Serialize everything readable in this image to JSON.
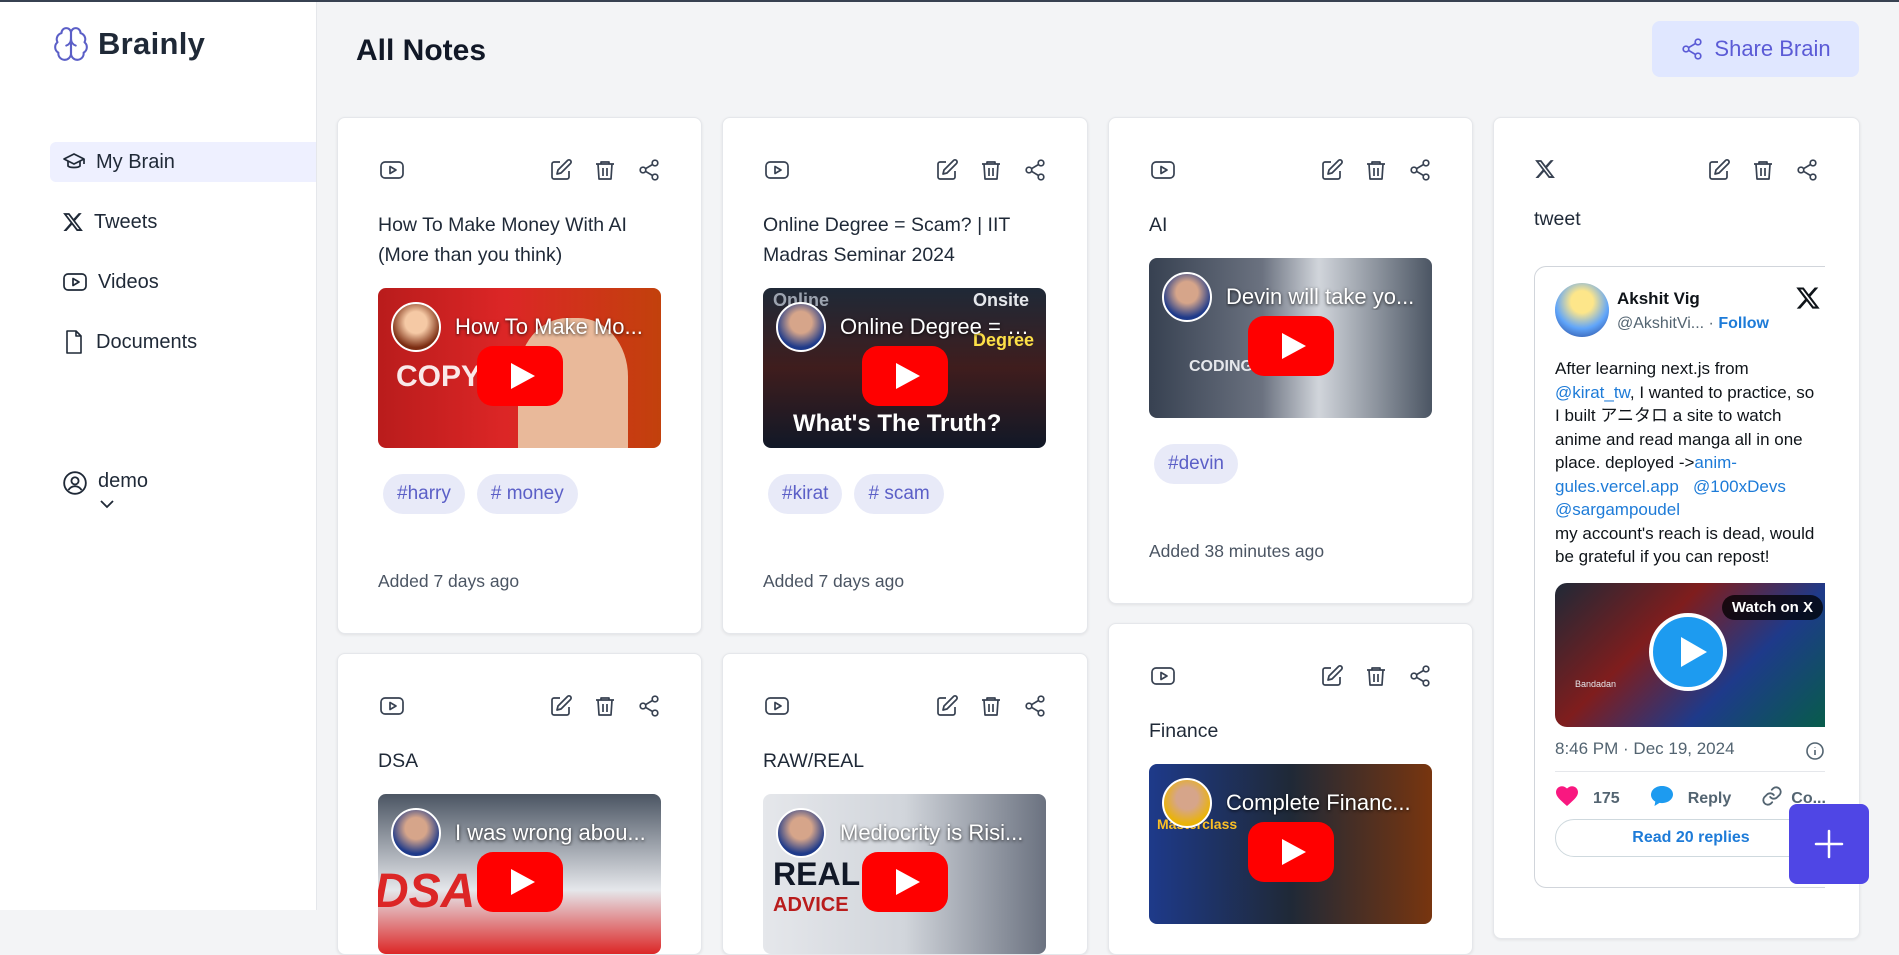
{
  "app": {
    "name": "Brainly"
  },
  "sidebar": {
    "items": [
      {
        "label": "My Brain",
        "icon": "graduation-cap-icon",
        "active": true
      },
      {
        "label": "Tweets",
        "icon": "x-logo-icon"
      },
      {
        "label": "Videos",
        "icon": "youtube-icon"
      },
      {
        "label": "Documents",
        "icon": "document-icon"
      }
    ],
    "user": {
      "name": "demo"
    }
  },
  "header": {
    "title": "All Notes",
    "share_label": "Share Brain"
  },
  "colors": {
    "accent": "#4f46e5",
    "tag_bg": "#e8eaf8",
    "tag_text": "#5b5fc7",
    "youtube_red": "#ff0000"
  },
  "cards": [
    {
      "type": "youtube",
      "title": "How To Make Money With AI (More than you think)",
      "video_title": "How To Make Mo...",
      "tags": [
        "#harry",
        "# money"
      ],
      "added": "Added 7 days ago"
    },
    {
      "type": "youtube",
      "title": "Online Degree = Scam? | IIT Madras Seminar 2024",
      "video_title": "Online Degree = S...",
      "tags": [
        "#kirat",
        "# scam"
      ],
      "added": "Added 7 days ago"
    },
    {
      "type": "youtube",
      "title": "AI",
      "video_title": "Devin will take yo...",
      "tags": [
        "#devin"
      ],
      "added": "Added 38 minutes ago"
    },
    {
      "type": "tweet",
      "title": "tweet"
    },
    {
      "type": "youtube",
      "title": "DSA",
      "video_title": "I was wrong abou..."
    },
    {
      "type": "youtube",
      "title": "RAW/REAL",
      "video_title": "Mediocrity is Risi..."
    },
    {
      "type": "youtube",
      "title": "Finance",
      "video_title": "Complete Financ..."
    }
  ],
  "video_texts": {
    "copy": "COPY",
    "truth": "What's The Truth?",
    "online": "Online",
    "onsite": "Onsite",
    "degree": "Degree",
    "coding": "CODING",
    "dsa": "DSA",
    "real": "REAL",
    "advice": "ADVICE",
    "masterclass": "Masterclass"
  },
  "tweet": {
    "author": "Akshit Vig",
    "handle": "@AkshitVi...",
    "follow": "Follow",
    "text_1": "After learning next.js from",
    "mention_1": "@kirat_tw",
    "text_2": ", I wanted to practice, so",
    "text_3": "I built アニタロ  a site to watch anime and read manga all in one place. deployed ->",
    "link": "anim-gules.vercel.app",
    "mention_2": "@100xDevs",
    "mention_3": "@sargampoudel",
    "text_4": "my account's reach is dead, would be grateful if you can repost!",
    "watch_label": "Watch on X",
    "media_caption": "Bandadan",
    "timestamp": "8:46 PM · Dec 19, 2024",
    "likes": "175",
    "reply": "Reply",
    "copy": "Co...",
    "read_replies": "Read 20 replies"
  }
}
